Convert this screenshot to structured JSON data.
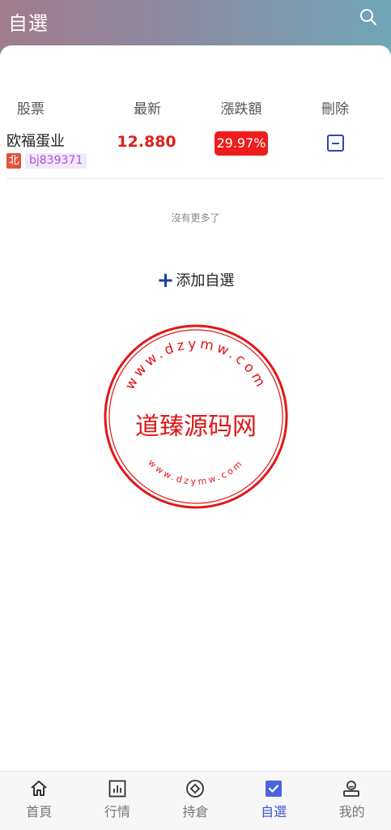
{
  "header": {
    "title": "自選",
    "search_icon": "search-icon"
  },
  "table": {
    "columns": [
      "股票",
      "最新",
      "漲跌額",
      "刪除"
    ],
    "rows": [
      {
        "name": "欧福蛋业",
        "market": "北",
        "code": "bj839371",
        "price": "12.880",
        "change": "29.97%",
        "delete_icon": "minus-square-icon"
      }
    ]
  },
  "list_footer": "沒有更多了",
  "add_watch": {
    "plus": "+",
    "label": "添加自選"
  },
  "watermark": {
    "text": "道臻源码网",
    "url_top": "www.dzymw.com",
    "url_bottom": "www.dzymw.com",
    "color": "#e01818"
  },
  "tabbar": {
    "tabs": [
      {
        "label": "首頁",
        "icon": "home-icon",
        "active": false
      },
      {
        "label": "行情",
        "icon": "chart-icon",
        "active": false
      },
      {
        "label": "持倉",
        "icon": "position-icon",
        "active": false
      },
      {
        "label": "自選",
        "icon": "check-square-icon",
        "active": true
      },
      {
        "label": "我的",
        "icon": "user-icon",
        "active": false
      }
    ]
  },
  "colors": {
    "accent": "#3a56d4",
    "up_red": "#ee1c1c",
    "code_purple": "#a855e0"
  }
}
